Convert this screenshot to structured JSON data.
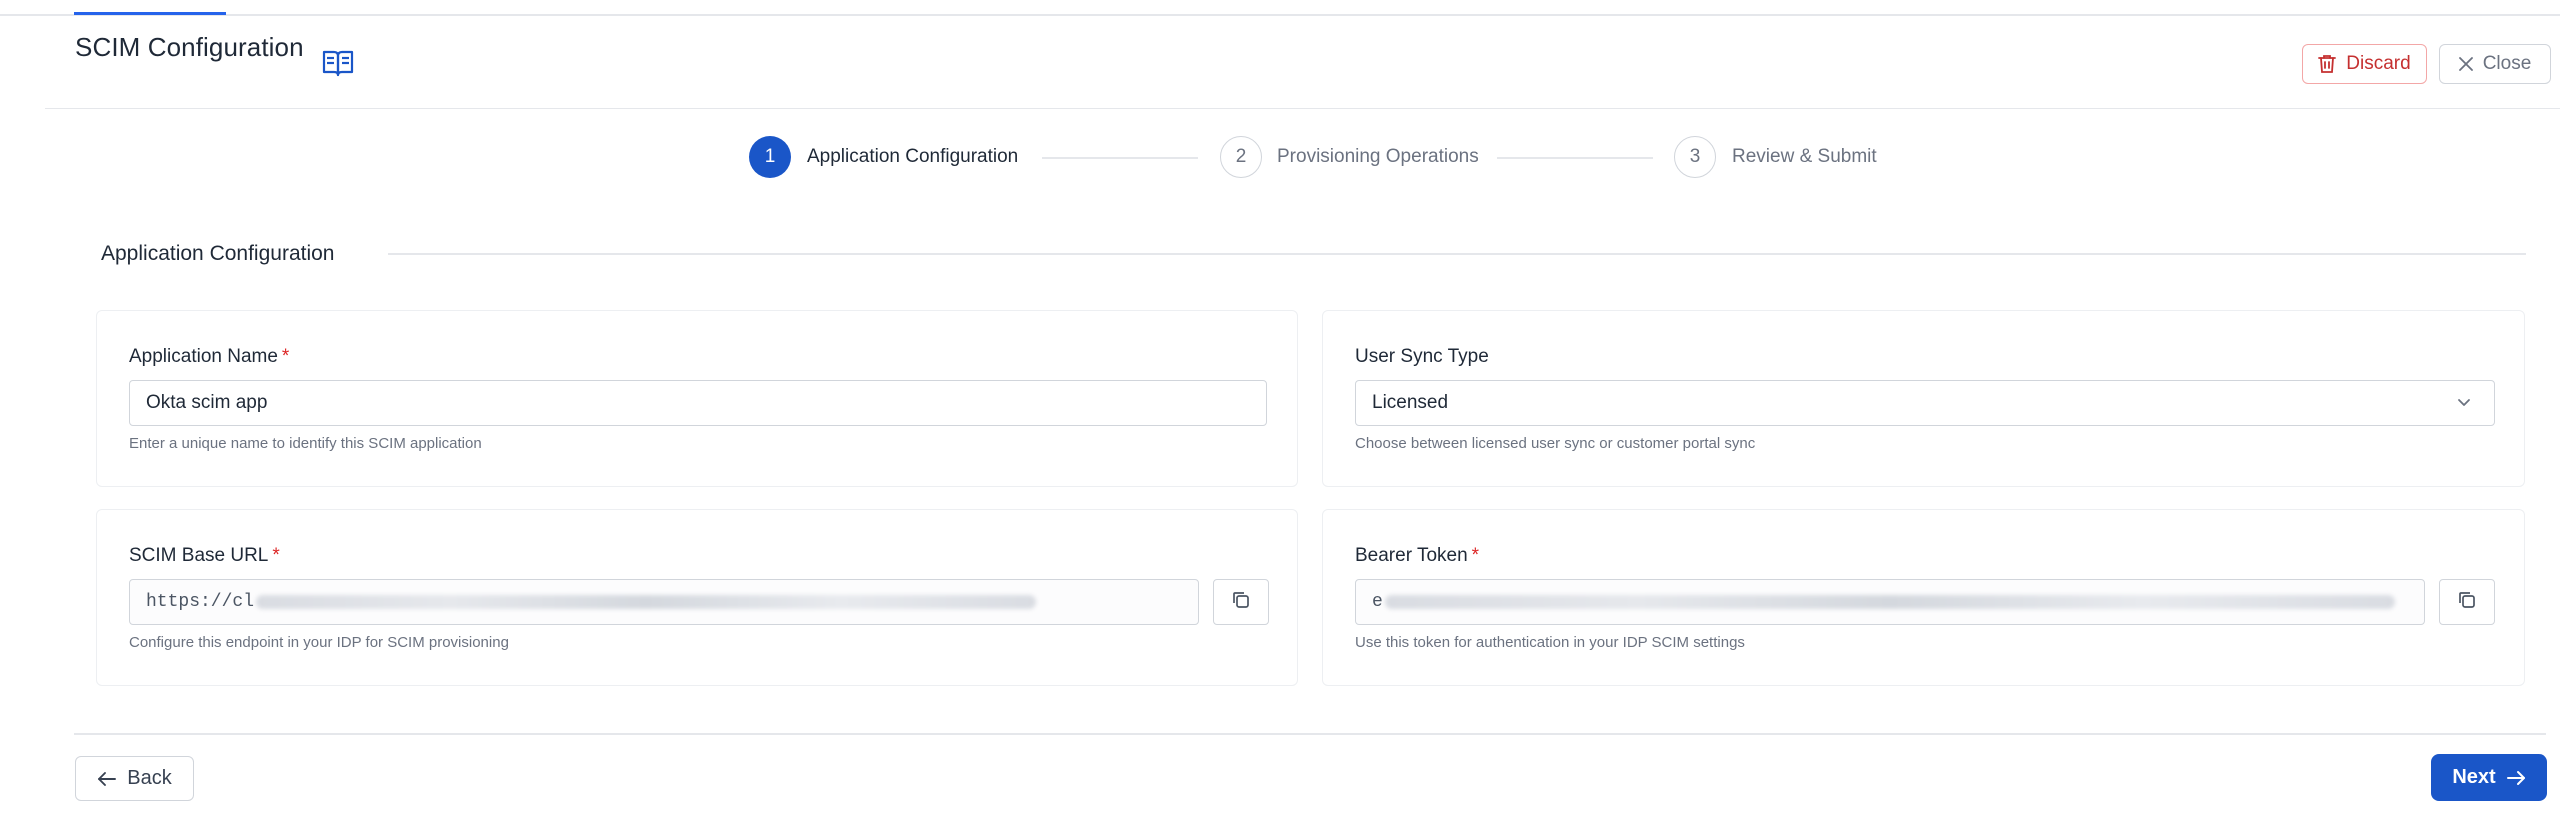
{
  "header": {
    "title": "SCIM Configuration",
    "doc_icon": "book-open-icon",
    "discard_label": "Discard",
    "close_label": "Close"
  },
  "stepper": {
    "steps": [
      {
        "number": "1",
        "label": "Application Configuration",
        "state": "active"
      },
      {
        "number": "2",
        "label": "Provisioning Operations",
        "state": "inactive"
      },
      {
        "number": "3",
        "label": "Review & Submit",
        "state": "inactive"
      }
    ]
  },
  "section": {
    "title": "Application Configuration"
  },
  "fields": {
    "app_name": {
      "label": "Application Name",
      "required": "*",
      "value": "Okta scim app",
      "helper": "Enter a unique name to identify this SCIM application"
    },
    "user_sync_type": {
      "label": "User Sync Type",
      "value": "Licensed",
      "helper": "Choose between licensed user sync or customer portal sync"
    },
    "scim_base_url": {
      "label": "SCIM Base URL",
      "required": "*",
      "value_prefix": "https://cl",
      "helper": "Configure this endpoint in your IDP for SCIM provisioning"
    },
    "bearer_token": {
      "label": "Bearer Token",
      "required": "*",
      "value_prefix": "e",
      "helper": "Use this token for authentication in your IDP SCIM settings"
    }
  },
  "footer": {
    "back_label": "Back",
    "next_label": "Next"
  },
  "colors": {
    "primary": "#1a56c8",
    "danger": "#c53030",
    "border": "#d1d5db"
  }
}
